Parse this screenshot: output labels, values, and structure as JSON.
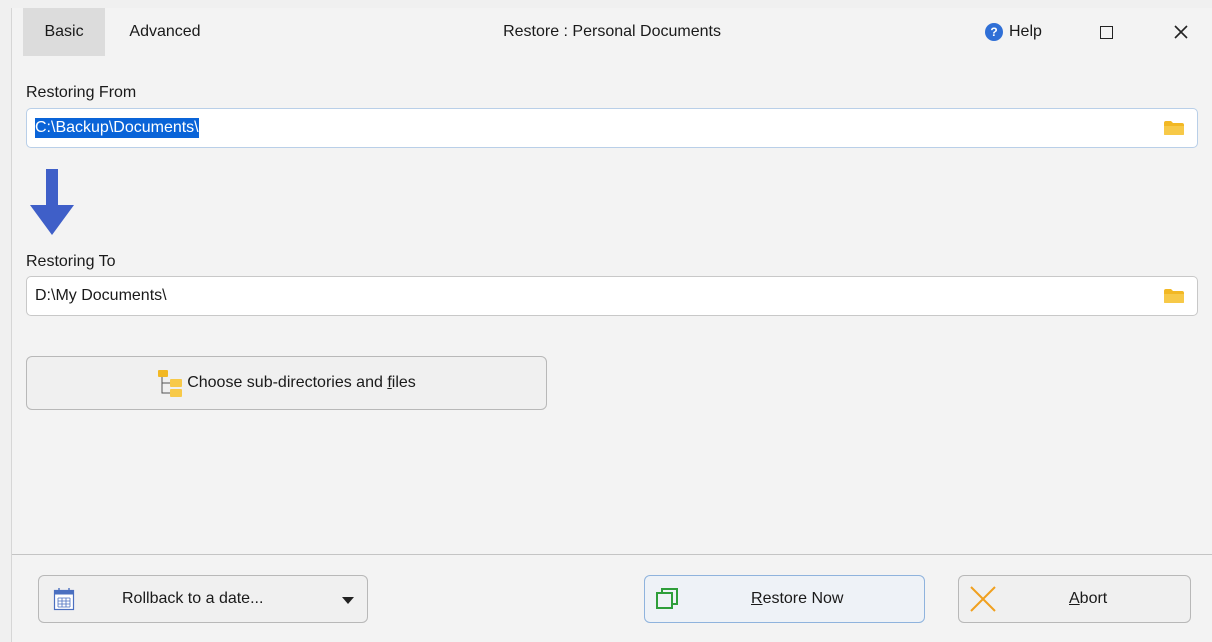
{
  "tabs": [
    {
      "label": "Basic",
      "active": true
    },
    {
      "label": "Advanced",
      "active": false
    }
  ],
  "window_title": "Restore : Personal Documents",
  "help_label": "Help",
  "source": {
    "label": "Restoring From",
    "value": "C:\\Backup\\Documents\\"
  },
  "destination": {
    "label": "Restoring To",
    "value": "D:\\My Documents\\"
  },
  "choose_button": {
    "pre": "Choose sub-directories and ",
    "accel": "f",
    "post": "iles"
  },
  "rollback_button": {
    "label": "Rollback to a date..."
  },
  "restore_button": {
    "accel": "R",
    "rest": "estore Now"
  },
  "abort_button": {
    "accel": "A",
    "rest": "bort"
  },
  "colors": {
    "accent_blue": "#2f6fd6",
    "arrow_blue": "#3f5fc8",
    "folder_yellow": "#f2b824",
    "selection": "#0a64d8",
    "restore_green": "#2e9e3a",
    "abort_orange": "#f0a020"
  },
  "icons": [
    "help-icon",
    "maximize-icon",
    "close-icon",
    "folder-icon",
    "down-arrow-icon",
    "folder-tree-icon",
    "calendar-icon",
    "chevron-down-icon",
    "restore-copy-icon",
    "abort-x-icon"
  ]
}
